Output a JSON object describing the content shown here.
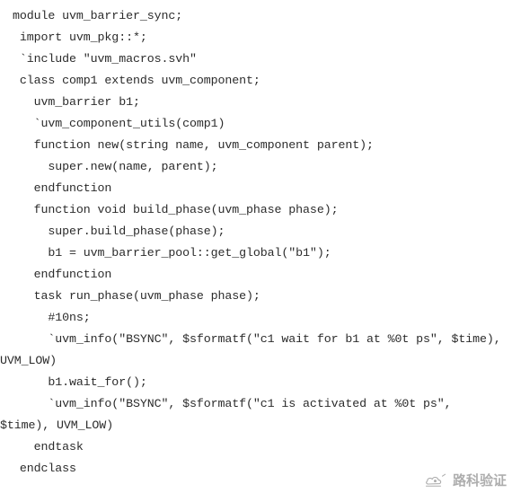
{
  "document": {
    "kind": "code-listing",
    "language": "SystemVerilog / UVM",
    "background_color": "#ffffff",
    "text_color": "#2b2b2b"
  },
  "code": {
    "lines": [
      {
        "text": "module uvm_barrier_sync;",
        "continuation": false
      },
      {
        "text": " import uvm_pkg::*;",
        "continuation": false
      },
      {
        "text": " `include \"uvm_macros.svh\"",
        "continuation": false
      },
      {
        "text": " class comp1 extends uvm_component;",
        "continuation": false
      },
      {
        "text": "   uvm_barrier b1;",
        "continuation": false
      },
      {
        "text": "   `uvm_component_utils(comp1)",
        "continuation": false
      },
      {
        "text": "   function new(string name, uvm_component parent);",
        "continuation": false
      },
      {
        "text": "     super.new(name, parent);",
        "continuation": false
      },
      {
        "text": "   endfunction",
        "continuation": false
      },
      {
        "text": "   function void build_phase(uvm_phase phase);",
        "continuation": false
      },
      {
        "text": "     super.build_phase(phase);",
        "continuation": false
      },
      {
        "text": "     b1 = uvm_barrier_pool::get_global(\"b1\");",
        "continuation": false
      },
      {
        "text": "   endfunction",
        "continuation": false
      },
      {
        "text": "   task run_phase(uvm_phase phase);",
        "continuation": false
      },
      {
        "text": "     #10ns;",
        "continuation": false
      },
      {
        "text": "     `uvm_info(\"BSYNC\", $sformatf(\"c1 wait for b1 at %0t ps\", $time),",
        "continuation": false
      },
      {
        "text": "UVM_LOW)",
        "continuation": true
      },
      {
        "text": "     b1.wait_for();",
        "continuation": false
      },
      {
        "text": "     `uvm_info(\"BSYNC\", $sformatf(\"c1 is activated at %0t ps\",",
        "continuation": false
      },
      {
        "text": "$time), UVM_LOW)",
        "continuation": true
      },
      {
        "text": "   endtask",
        "continuation": false
      },
      {
        "text": " endclass",
        "continuation": false
      }
    ]
  },
  "watermark": {
    "text": "路科验证",
    "icon": "cloud-mark-logo",
    "color": "#3d3d3d"
  }
}
